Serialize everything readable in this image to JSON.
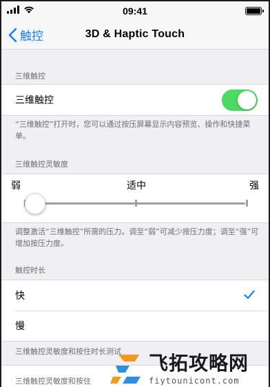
{
  "status_bar": {
    "time": "09:41"
  },
  "nav": {
    "back_label": "触控",
    "title": "3D & Haptic Touch"
  },
  "section_3d": {
    "header": "三维触控",
    "row_label": "三维触控",
    "toggle_on": true,
    "footer": "“三维触控”打开时，您可以通过按压屏幕显示内容预览、操作和快捷菜单。"
  },
  "section_sensitivity": {
    "header": "三维触控灵敏度",
    "labels": [
      "弱",
      "适中",
      "强"
    ],
    "level": 0,
    "footer": "调整激活“三维触控”所需的压力。调至“弱”可减少按压力度；调至“强”可增加按压力度。"
  },
  "section_duration": {
    "header": "触控时长",
    "options": [
      "快",
      "慢"
    ],
    "selected": "快"
  },
  "section_test": {
    "header": "三维触控灵敏度和按住时长测试",
    "row_label": "三维触控灵敏度和按住"
  },
  "watermark": {
    "title": "飞拓攻略网",
    "url": "fiytounicont.com"
  },
  "colors": {
    "accent": "#1a7df6",
    "toggle_on": "#4cd964",
    "background": "#efeff4"
  }
}
